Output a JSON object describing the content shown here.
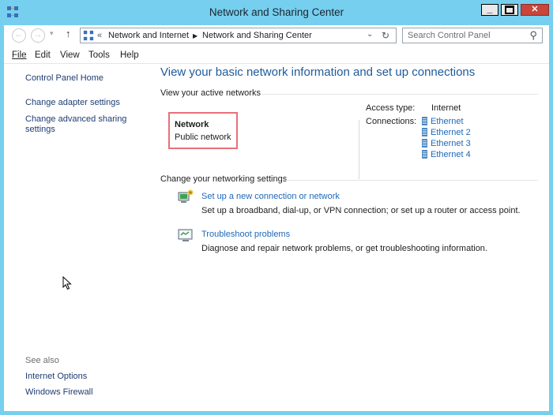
{
  "window": {
    "title": "Network and Sharing Center"
  },
  "address": {
    "chevrons": "«",
    "crumbs": [
      "Network and Internet",
      "Network and Sharing Center"
    ]
  },
  "search": {
    "placeholder": "Search Control Panel"
  },
  "menu": [
    {
      "label": "File"
    },
    {
      "label": "Edit"
    },
    {
      "label": "View"
    },
    {
      "label": "Tools"
    },
    {
      "label": "Help"
    }
  ],
  "sidebar": {
    "home": "Control Panel Home",
    "adapter": "Change adapter settings",
    "advanced_1": "Change advanced sharing",
    "advanced_2": "settings",
    "see_also": "See also",
    "internet_options": "Internet Options",
    "firewall": "Windows Firewall"
  },
  "main": {
    "heading": "View your basic network information and set up connections",
    "active_label": "View your active networks",
    "network": {
      "name": "Network",
      "type": "Public network"
    },
    "access": {
      "label": "Access type:",
      "value": "Internet"
    },
    "connections": {
      "label": "Connections:",
      "items": [
        "Ethernet",
        "Ethernet 2",
        "Ethernet 3",
        "Ethernet 4"
      ]
    },
    "change_label": "Change your networking settings",
    "tasks": [
      {
        "title": "Set up a new connection or network",
        "desc": "Set up a broadband, dial-up, or VPN connection; or set up a router or access point."
      },
      {
        "title": "Troubleshoot problems",
        "desc": "Diagnose and repair network problems, or get troubleshooting information."
      }
    ]
  },
  "colors": {
    "accent_link": "#1e69b8",
    "heading": "#1e5a9c",
    "frame": "#76cfee",
    "highlight_box": "#e8707a"
  }
}
